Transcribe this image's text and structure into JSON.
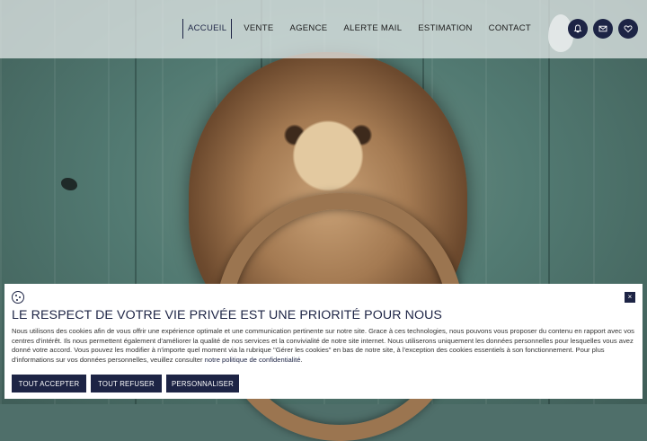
{
  "nav": {
    "items": [
      {
        "label": "ACCUEIL",
        "active": true
      },
      {
        "label": "VENTE"
      },
      {
        "label": "AGENCE"
      },
      {
        "label": "ALERTE MAIL"
      },
      {
        "label": "ESTIMATION"
      },
      {
        "label": "CONTACT"
      }
    ]
  },
  "header_icons": [
    "bell-icon",
    "mail-icon",
    "heart-icon"
  ],
  "cookie": {
    "title": "LE RESPECT DE VOTRE VIE PRIVÉE EST UNE PRIORITÉ POUR NOUS",
    "text": "Nous utilisons des cookies afin de vous offrir une expérience optimale et une communication pertinente sur notre site. Grace à ces technologies, nous pouvons vous proposer du contenu en rapport avec vos centres d'intérêt. Ils nous permettent également d'améliorer la qualité de nos services et la convivialité de notre site internet. Nous utiliserons uniquement les données personnelles pour lesquelles vous avez donné votre accord. Vous pouvez les modifier à n'importe quel moment via la rubrique \"Gérer les cookies\" en bas de notre site, à l'exception des cookies essentiels à son fonctionnement. Pour plus d'informations sur vos données personnelles, veuillez consulter ",
    "link": "notre politique de confidentialité",
    "text_end": ".",
    "close": "×",
    "buttons": {
      "accept": "TOUT ACCEPTER",
      "refuse": "TOUT REFUSER",
      "customize": "PERSONNALISER"
    }
  },
  "colors": {
    "brand": "#1d2445",
    "header_bg": "#ebf0f0",
    "banner_bg": "#ffffff"
  }
}
